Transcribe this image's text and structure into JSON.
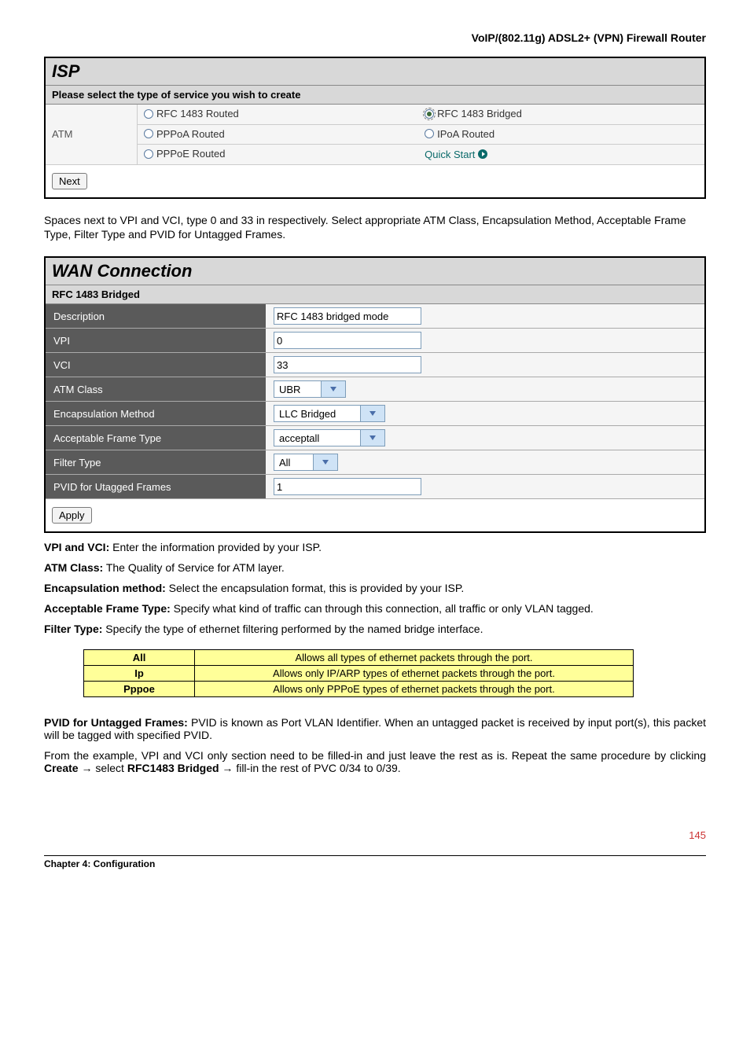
{
  "header": {
    "title": "VoIP/(802.11g) ADSL2+ (VPN) Firewall Router"
  },
  "isp_panel": {
    "title": "ISP",
    "subtitle": "Please select the type of service you wish to create",
    "row_head": "ATM",
    "options": {
      "rfc_routed": "RFC 1483 Routed",
      "rfc_bridged": "RFC 1483 Bridged",
      "pppoa": "PPPoA Routed",
      "ipoa": "IPoA Routed",
      "pppoe": "PPPoE Routed",
      "quick_start": "Quick Start"
    },
    "next_btn": "Next"
  },
  "para1": "Spaces next to VPI and VCI, type 0 and 33 in respectively. Select appropriate ATM Class, Encapsulation Method, Acceptable Frame Type, Filter Type and PVID for Untagged Frames.",
  "wan_panel": {
    "title": "WAN Connection",
    "subtitle": "RFC 1483 Bridged",
    "rows": {
      "description": {
        "label": "Description",
        "value": "RFC 1483 bridged mode"
      },
      "vpi": {
        "label": "VPI",
        "value": "0"
      },
      "vci": {
        "label": "VCI",
        "value": "33"
      },
      "atm_class": {
        "label": "ATM Class",
        "value": "UBR"
      },
      "encap": {
        "label": "Encapsulation Method",
        "value": "LLC Bridged"
      },
      "frame_type": {
        "label": "Acceptable Frame Type",
        "value": "acceptall"
      },
      "filter_type": {
        "label": "Filter Type",
        "value": "All"
      },
      "pvid": {
        "label": "PVID for Utagged Frames",
        "value": "1"
      }
    },
    "apply_btn": "Apply"
  },
  "descs": {
    "vpi_vci": {
      "head": "VPI and VCI:",
      "body": " Enter the information provided by your ISP."
    },
    "atm": {
      "head": "ATM Class:",
      "body": " The Quality of Service for ATM layer."
    },
    "encap": {
      "head": "Encapsulation method:",
      "body": " Select the encapsulation format, this is provided by your ISP."
    },
    "aft": {
      "head": "Acceptable Frame Type:",
      "body": " Specify what kind of traffic can through this connection, all traffic or only VLAN tagged."
    },
    "ft": {
      "head": "Filter Type:",
      "body": " Specify the type of ethernet filtering performed by the named bridge interface."
    }
  },
  "filter_table": {
    "rows": [
      {
        "h": "All",
        "d": "Allows all types of ethernet packets through the port."
      },
      {
        "h": "Ip",
        "d": "Allows only IP/ARP types of ethernet packets through the port."
      },
      {
        "h": "Pppoe",
        "d": "Allows only PPPoE types of ethernet packets through the port."
      }
    ]
  },
  "para_pvid": {
    "head": "PVID for Untagged Frames:",
    "body": " PVID is known as Port VLAN Identifier.  When an untagged packet is received by input port(s), this packet will be tagged with specified PVID."
  },
  "para_last": {
    "pre": "From the example, VPI and VCI only section need to be filled-in and just leave the rest as is.    Repeat the same procedure by clicking ",
    "create": "Create",
    "arrow1": " → select ",
    "rfc": "RFC1483 Bridged",
    "arrow2": " → fill-in the rest of PVC 0/34 to 0/39."
  },
  "footer": {
    "page_num": "145",
    "chapter": "Chapter 4: Configuration"
  }
}
